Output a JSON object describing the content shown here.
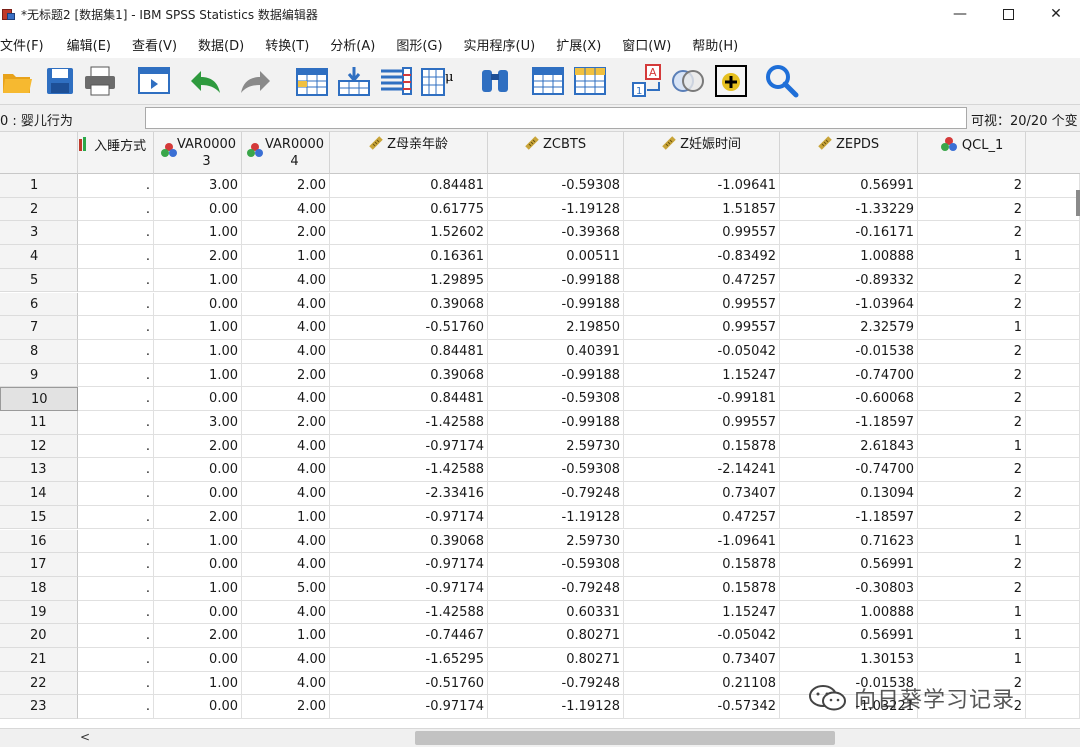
{
  "window": {
    "title": "*无标题2 [数据集1] - IBM SPSS Statistics 数据编辑器",
    "minimize": "—",
    "close": "✕"
  },
  "menu": [
    "文件(F)",
    "编辑(E)",
    "查看(V)",
    "数据(D)",
    "转换(T)",
    "分析(A)",
    "图形(G)",
    "实用程序(U)",
    "扩展(X)",
    "窗口(W)",
    "帮助(H)"
  ],
  "toolbar_icons": [
    "open-folder-icon",
    "save-icon",
    "print-icon",
    "dialog-recall-icon",
    "undo-icon",
    "redo-icon",
    "goto-case-icon",
    "goto-variable-icon",
    "variables-icon",
    "split-file-icon",
    "find-icon",
    "insert-cases-icon",
    "insert-variable-icon",
    "value-labels-icon",
    "use-sets-icon",
    "show-all-variables-icon",
    "spelling-icon"
  ],
  "cell_editor": {
    "cell_ref": "0 : 婴儿行为",
    "value": "",
    "visible": "可视：20/20 个变"
  },
  "columns": [
    {
      "name": "入睡方式",
      "icon": "ordinal-bar-icon"
    },
    {
      "name": "VAR0000\n3",
      "icon": "nominal-icon"
    },
    {
      "name": "VAR0000\n4",
      "icon": "nominal-icon"
    },
    {
      "name": "Z母亲年龄",
      "icon": "scale-ruler-icon"
    },
    {
      "name": "ZCBTS",
      "icon": "scale-ruler-icon"
    },
    {
      "name": "Z妊娠时间",
      "icon": "scale-ruler-icon"
    },
    {
      "name": "ZEPDS",
      "icon": "scale-ruler-icon"
    },
    {
      "name": "QCL_1",
      "icon": "nominal-icon"
    }
  ],
  "rows": [
    [
      "1",
      ".",
      "3.00",
      "2.00",
      "0.84481",
      "-0.59308",
      "-1.09641",
      "0.56991",
      "2"
    ],
    [
      "2",
      ".",
      "0.00",
      "4.00",
      "0.61775",
      "-1.19128",
      "1.51857",
      "-1.33229",
      "2"
    ],
    [
      "3",
      ".",
      "1.00",
      "2.00",
      "1.52602",
      "-0.39368",
      "0.99557",
      "-0.16171",
      "2"
    ],
    [
      "4",
      ".",
      "2.00",
      "1.00",
      "0.16361",
      "0.00511",
      "-0.83492",
      "1.00888",
      "1"
    ],
    [
      "5",
      ".",
      "1.00",
      "4.00",
      "1.29895",
      "-0.99188",
      "0.47257",
      "-0.89332",
      "2"
    ],
    [
      "6",
      ".",
      "0.00",
      "4.00",
      "0.39068",
      "-0.99188",
      "0.99557",
      "-1.03964",
      "2"
    ],
    [
      "7",
      ".",
      "1.00",
      "4.00",
      "-0.51760",
      "2.19850",
      "0.99557",
      "2.32579",
      "1"
    ],
    [
      "8",
      ".",
      "1.00",
      "4.00",
      "0.84481",
      "0.40391",
      "-0.05042",
      "-0.01538",
      "2"
    ],
    [
      "9",
      ".",
      "1.00",
      "2.00",
      "0.39068",
      "-0.99188",
      "1.15247",
      "-0.74700",
      "2"
    ],
    [
      "10",
      ".",
      "0.00",
      "4.00",
      "0.84481",
      "-0.59308",
      "-0.99181",
      "-0.60068",
      "2"
    ],
    [
      "11",
      ".",
      "3.00",
      "2.00",
      "-1.42588",
      "-0.99188",
      "0.99557",
      "-1.18597",
      "2"
    ],
    [
      "12",
      ".",
      "2.00",
      "4.00",
      "-0.97174",
      "2.59730",
      "0.15878",
      "2.61843",
      "1"
    ],
    [
      "13",
      ".",
      "0.00",
      "4.00",
      "-1.42588",
      "-0.59308",
      "-2.14241",
      "-0.74700",
      "2"
    ],
    [
      "14",
      ".",
      "0.00",
      "4.00",
      "-2.33416",
      "-0.79248",
      "0.73407",
      "0.13094",
      "2"
    ],
    [
      "15",
      ".",
      "2.00",
      "1.00",
      "-0.97174",
      "-1.19128",
      "0.47257",
      "-1.18597",
      "2"
    ],
    [
      "16",
      ".",
      "1.00",
      "4.00",
      "0.39068",
      "2.59730",
      "-1.09641",
      "0.71623",
      "1"
    ],
    [
      "17",
      ".",
      "0.00",
      "4.00",
      "-0.97174",
      "-0.59308",
      "0.15878",
      "0.56991",
      "2"
    ],
    [
      "18",
      ".",
      "1.00",
      "5.00",
      "-0.97174",
      "-0.79248",
      "0.15878",
      "-0.30803",
      "2"
    ],
    [
      "19",
      ".",
      "0.00",
      "4.00",
      "-1.42588",
      "0.60331",
      "1.15247",
      "1.00888",
      "1"
    ],
    [
      "20",
      ".",
      "2.00",
      "1.00",
      "-0.74467",
      "0.80271",
      "-0.05042",
      "0.56991",
      "1"
    ],
    [
      "21",
      ".",
      "0.00",
      "4.00",
      "-1.65295",
      "0.80271",
      "0.73407",
      "1.30153",
      "1"
    ],
    [
      "22",
      ".",
      "1.00",
      "4.00",
      "-0.51760",
      "-0.79248",
      "0.21108",
      "-0.01538",
      "2"
    ],
    [
      "23",
      ".",
      "0.00",
      "2.00",
      "-0.97174",
      "-1.19128",
      "-0.57342",
      "-1.03221",
      "2"
    ]
  ],
  "active_row": "10",
  "scrollbar": {
    "left_arrow": "<"
  },
  "watermark": "向日葵学习记录",
  "colors": {
    "header_bg": "#f4f4f4",
    "active_row_bg": "#e2e2e2",
    "scrollbar_thumb": "#c2c2c2",
    "nominal_red": "#d43a3a",
    "nominal_green": "#3aa64a",
    "nominal_blue": "#3a6fd4",
    "scale_ruler": "#c9a53a"
  }
}
